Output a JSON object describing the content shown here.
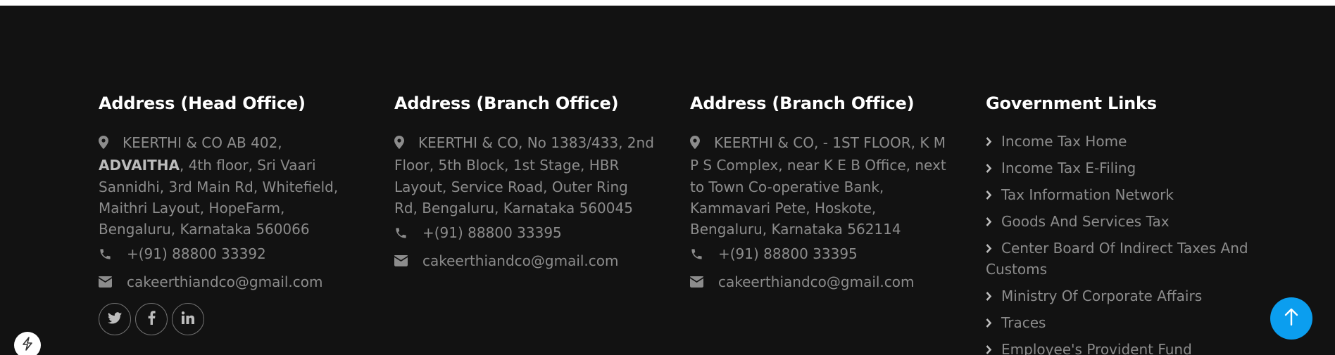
{
  "footer": {
    "head_office": {
      "title": "Address (Head Office)",
      "addr_pre": "KEERTHI & CO AB 402, ",
      "addr_bold": "ADVAITHA",
      "addr_post": ", 4th floor, Sri Vaari Sannidhi, 3rd Main Rd, Whitefield, Maithri Layout, HopeFarm, Bengaluru, Karnataka 560066",
      "phone": "+(91) 88800 33392",
      "email": "cakeerthiandco@gmail.com"
    },
    "branch1": {
      "title": "Address (Branch Office)",
      "address": "KEERTHI & CO, No 1383/433, 2nd Floor, 5th Block, 1st Stage, HBR Layout, Service Road, Outer Ring Rd, Bengaluru, Karnataka 560045",
      "phone": "+(91) 88800 33395",
      "email": "cakeerthiandco@gmail.com"
    },
    "branch2": {
      "title": "Address (Branch Office)",
      "address": "KEERTHI & CO, - 1ST FLOOR, K M P S Complex, near K E B Office, next to Town Co-operative Bank, Kammavari Pete, Hoskote, Bengaluru, Karnataka 562114",
      "phone": "+(91) 88800 33395",
      "email": "cakeerthiandco@gmail.com"
    },
    "gov": {
      "title": "Government Links",
      "links": [
        "Income Tax Home",
        "Income Tax E-Filing",
        "Tax Information Network",
        "Goods And Services Tax",
        "Center Board Of Indirect Taxes And Customs",
        "Ministry Of Corporate Affairs",
        "Traces",
        "Employee's Provident Fund"
      ]
    },
    "social_icons": [
      "twitter-icon",
      "facebook-icon",
      "linkedin-icon"
    ]
  },
  "colors": {
    "background": "#121212",
    "heading": "#ffffff",
    "text": "#8c8c8c",
    "accent": "#0b9eef"
  }
}
